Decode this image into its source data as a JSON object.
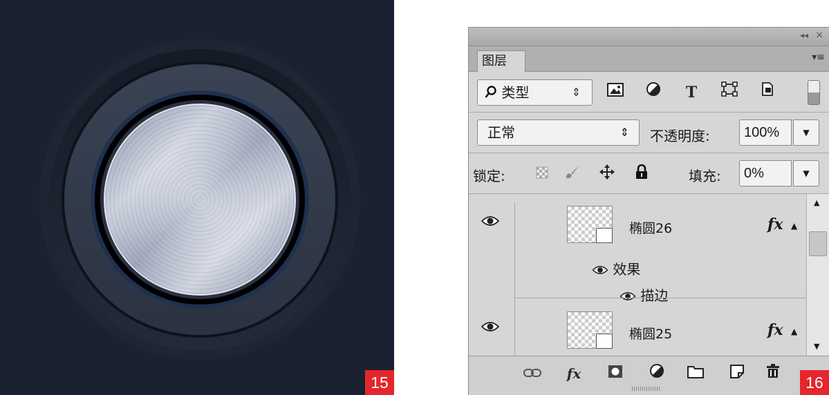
{
  "badges": {
    "left": "15",
    "right": "16"
  },
  "colors": {
    "canvas_bg": "#1a2130",
    "badge_red": "#e4262d",
    "panel_bg": "#d6d6d6"
  },
  "panel": {
    "title_icons": {
      "collapse": "◂◂",
      "close": "×"
    },
    "tab_label": "图层",
    "menu_icon": "▾≡",
    "filter": {
      "kind_label": "类型",
      "kind_arrows": "⇕",
      "icons": [
        "image-filter-icon",
        "adjustment-filter-icon",
        "type-filter-icon",
        "shape-filter-icon",
        "smart-object-filter-icon"
      ],
      "type_glyph": "T"
    },
    "blend_mode": "正常",
    "blend_arrows": "⇕",
    "opacity_label": "不透明度:",
    "opacity_value": "100%",
    "lock_label": "锁定:",
    "fill_label": "填充:",
    "fill_value": "0%",
    "layers": [
      {
        "name": "椭圆26",
        "fx": "fx",
        "effects_label": "效果",
        "stroke_label": "描边",
        "visible": true
      },
      {
        "name": "椭圆25",
        "fx": "fx",
        "visible": true
      }
    ],
    "bottom_icons": [
      "link-layers-icon",
      "fx-icon",
      "add-mask-icon",
      "adjustment-layer-icon",
      "new-group-icon",
      "new-layer-icon",
      "trash-icon"
    ],
    "bottom_fx": "fx"
  }
}
